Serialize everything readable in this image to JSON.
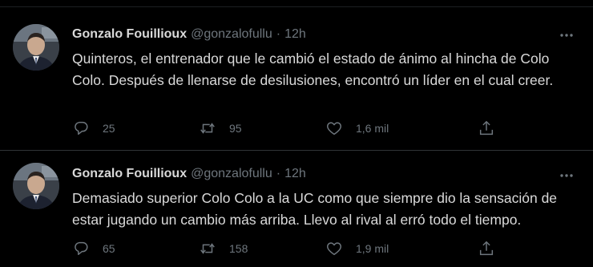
{
  "colors": {
    "background": "#000000",
    "text": "#d9d9d9",
    "secondary": "#6e767d",
    "divider": "#2f3336"
  },
  "tweets": [
    {
      "author": {
        "name": "Gonzalo Fouillioux",
        "handle": "@gonzalofullu"
      },
      "separator": "·",
      "time": "12h",
      "text": "Quinteros, el entrenador que le cambió el estado de ánimo al hincha de Colo Colo. Después de llenarse de desilusiones, encontró un líder en el cual creer.",
      "replies": "25",
      "retweets": "95",
      "likes": "1,6 mil",
      "icons": [
        "more-icon",
        "reply-icon",
        "retweet-icon",
        "like-icon",
        "share-icon"
      ]
    },
    {
      "author": {
        "name": "Gonzalo Fouillioux",
        "handle": "@gonzalofullu"
      },
      "separator": "·",
      "time": "12h",
      "text": "Demasiado superior Colo Colo a la UC como que siempre dio la sensación de estar jugando un cambio más arriba. Llevo al rival al erró todo el tiempo.",
      "replies": "65",
      "retweets": "158",
      "likes": "1,9 mil",
      "icons": [
        "more-icon",
        "reply-icon",
        "retweet-icon",
        "like-icon",
        "share-icon"
      ]
    }
  ]
}
